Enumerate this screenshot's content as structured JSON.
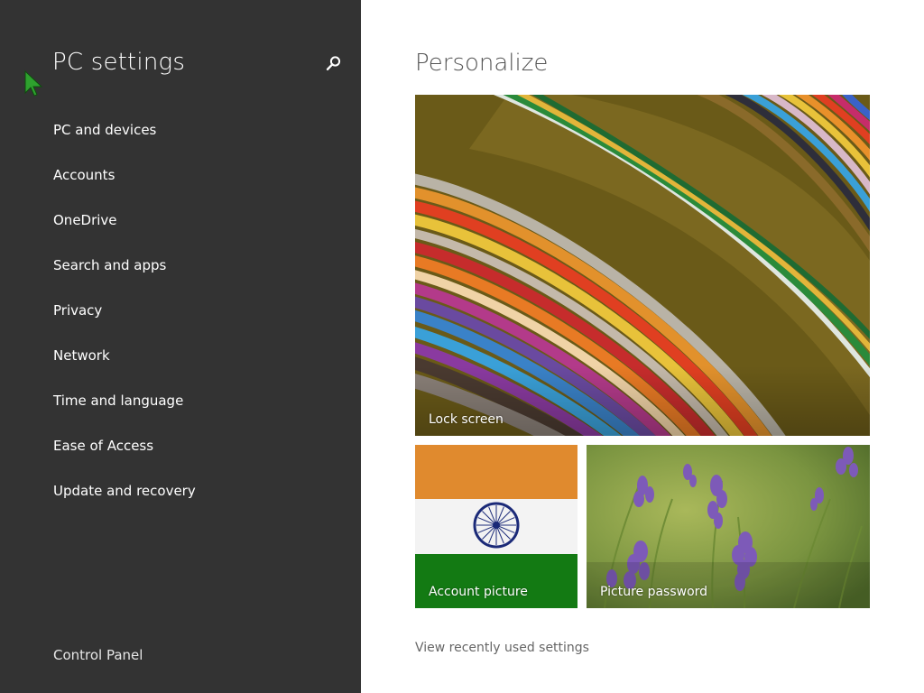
{
  "sidebar": {
    "title": "PC settings",
    "search_icon": "search-icon",
    "items": [
      {
        "label": "PC and devices"
      },
      {
        "label": "Accounts"
      },
      {
        "label": "OneDrive"
      },
      {
        "label": "Search and apps"
      },
      {
        "label": "Privacy"
      },
      {
        "label": "Network"
      },
      {
        "label": "Time and language"
      },
      {
        "label": "Ease of Access"
      },
      {
        "label": "Update and recovery"
      }
    ],
    "footer_link": "Control Panel"
  },
  "main": {
    "title": "Personalize",
    "tiles": {
      "lock_screen": "Lock screen",
      "account_picture": "Account picture",
      "picture_password": "Picture password"
    },
    "recent_link": "View recently used settings"
  },
  "colors": {
    "sidebar_bg": "#333333",
    "flag_saffron": "#e08a2e",
    "flag_white": "#f3f3f3",
    "flag_green": "#137a13",
    "chakra_blue": "#1b2a78",
    "cursor_green": "#2ea12e"
  }
}
